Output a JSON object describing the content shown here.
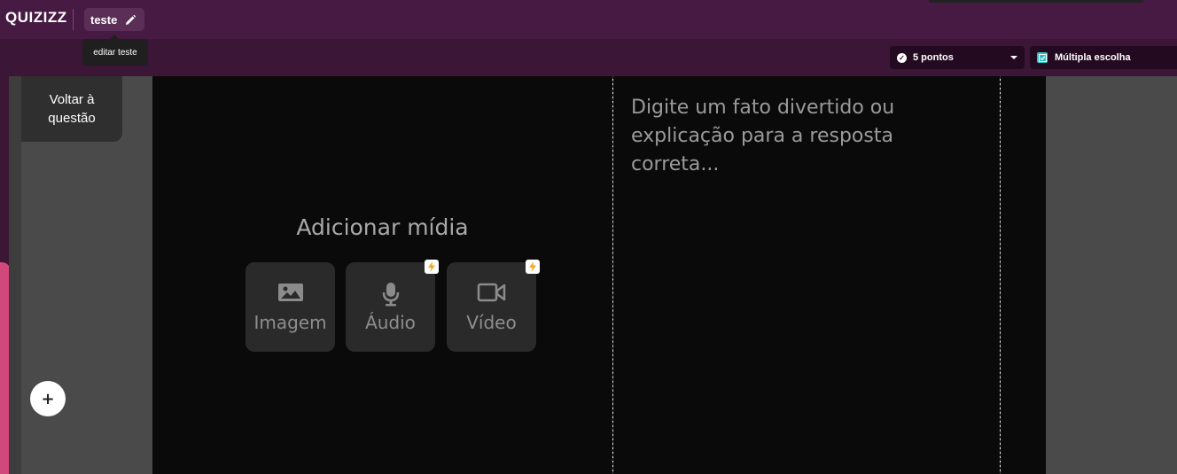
{
  "header": {
    "logo": "QUIZIZZ",
    "quiz_title": "teste",
    "edit_tooltip": "editar teste",
    "points_label": "5 pontos",
    "question_type_label": "Múltipla escolha"
  },
  "sidebar": {
    "back_label_line1": "Voltar à",
    "back_label_line2": "questão",
    "add_label": "+"
  },
  "media": {
    "title": "Adicionar mídia",
    "buttons": [
      {
        "label": "Imagem",
        "icon": "image-icon",
        "premium": false
      },
      {
        "label": "Áudio",
        "icon": "microphone-icon",
        "premium": true
      },
      {
        "label": "Vídeo",
        "icon": "video-icon",
        "premium": true
      }
    ]
  },
  "explanation": {
    "placeholder": "Digite um fato divertido ou explicação para a resposta correta..."
  },
  "colors": {
    "topbar": "#461a42",
    "subbar": "#3c1637",
    "accent_pink": "#d1487a",
    "premium_bolt": "#f5a623",
    "type_icon": "#2ec4c6"
  }
}
